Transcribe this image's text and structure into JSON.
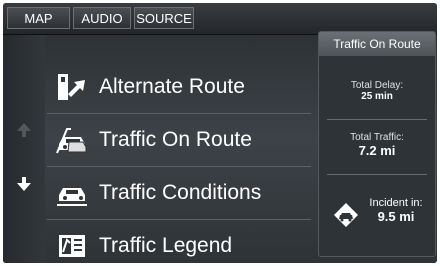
{
  "tabs": [
    {
      "label": "MAP"
    },
    {
      "label": "AUDIO"
    },
    {
      "label": "SOURCE"
    }
  ],
  "menu": [
    {
      "label": "Alternate Route",
      "icon": "alternate-route-icon"
    },
    {
      "label": "Traffic On Route",
      "icon": "traffic-on-route-icon"
    },
    {
      "label": "Traffic Conditions",
      "icon": "traffic-conditions-icon"
    },
    {
      "label": "Traffic Legend",
      "icon": "traffic-legend-icon"
    }
  ],
  "panel": {
    "title": "Traffic On Route",
    "total_delay_label": "Total Delay:",
    "total_delay_value": "25 min",
    "total_traffic_label": "Total Traffic:",
    "total_traffic_value": "7.2 mi",
    "incident_label": "Incident in:",
    "incident_value": "9.5 mi"
  }
}
